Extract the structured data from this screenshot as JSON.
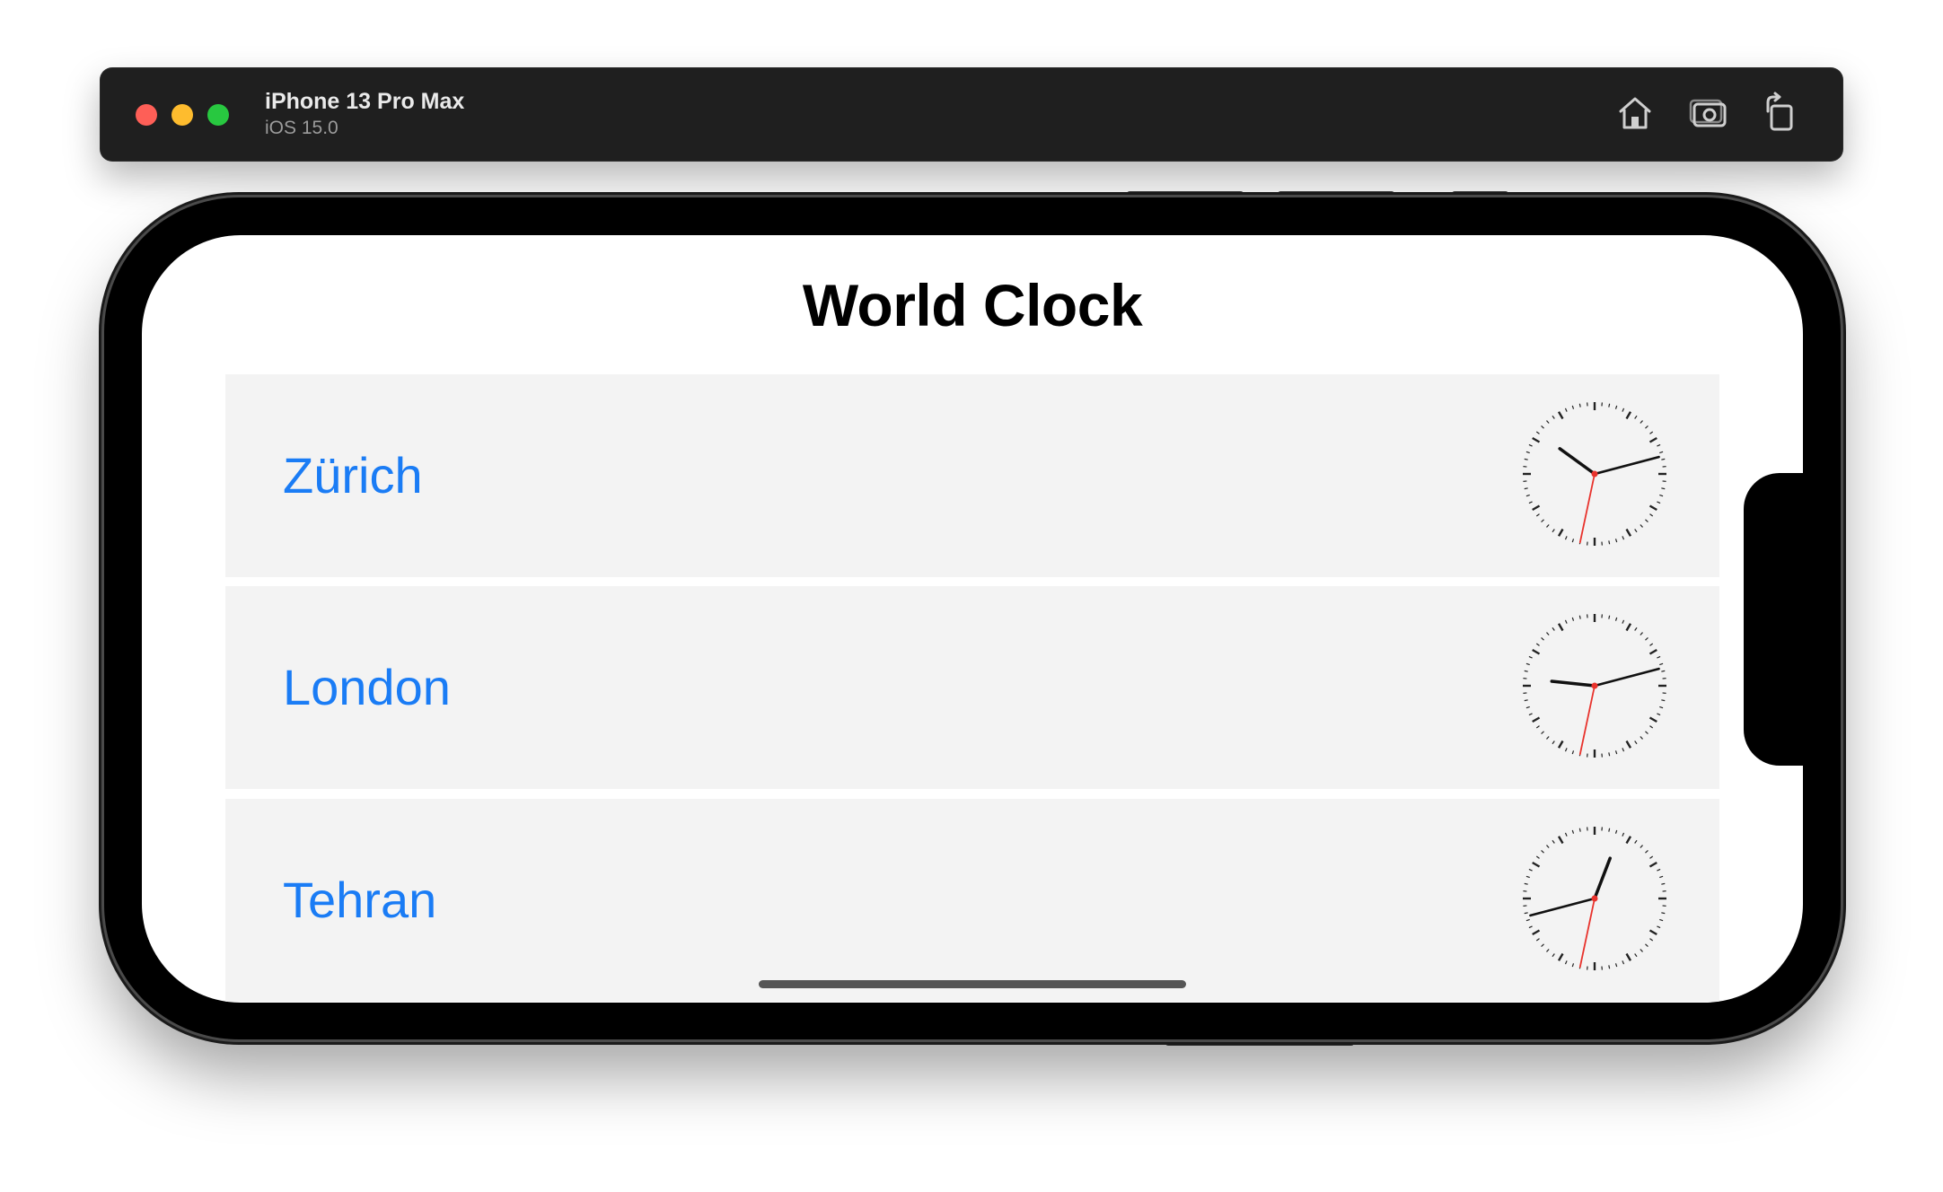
{
  "window": {
    "device_name": "iPhone 13 Pro Max",
    "os_version": "iOS 15.0",
    "toolbar_icons": [
      "home-icon",
      "screenshot-icon",
      "rotate-icon"
    ]
  },
  "app": {
    "title": "World Clock",
    "accent_color": "#1a7cf5",
    "cities": [
      {
        "name": "Zürich",
        "hour": 10,
        "minute": 12,
        "second": 32
      },
      {
        "name": "London",
        "hour": 9,
        "minute": 12,
        "second": 32
      },
      {
        "name": "Tehran",
        "hour": 12,
        "minute": 42,
        "second": 32
      }
    ]
  }
}
